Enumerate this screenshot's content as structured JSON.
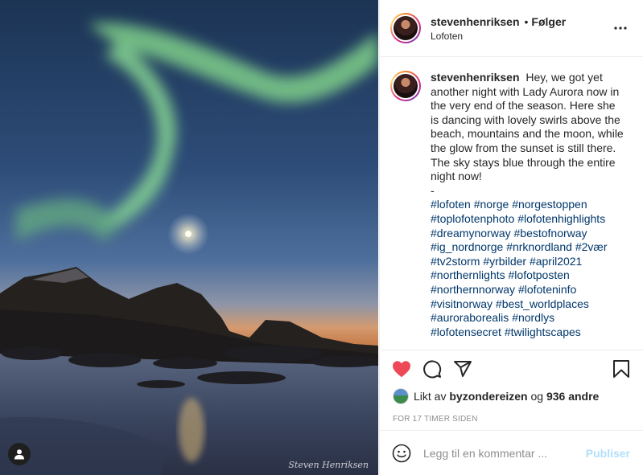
{
  "photo": {
    "user_tag_icon": "user-tag-icon",
    "watermark": "Steven Henriksen"
  },
  "header": {
    "username": "stevenhenriksen",
    "separator": "•",
    "follow_label": "Følger",
    "location": "Lofoten",
    "more_icon": "more-icon"
  },
  "caption": {
    "username": "stevenhenriksen",
    "text": "Hey, we got yet another night with Lady Aurora now in the very end of the season. Here she is dancing with lovely swirls above the beach, mountains and the moon, while the glow from the sunset is still there. The sky stays blue through the entire night now!",
    "dash": "-",
    "hashtags": [
      "#lofoten",
      "#norge",
      "#norgestoppen",
      "#toplofotenphoto",
      "#lofotenhighlights",
      "#dreamynorway",
      "#bestofnorway",
      "#ig_nordnorge",
      "#nrknordland",
      "#2vær",
      "#tv2storm",
      "#yrbilder",
      "#april2021",
      "#northernlights",
      "#lofotposten",
      "#northernnorway",
      "#lofoteninfo",
      "#visitnorway",
      "#best_worldplaces",
      "#auroraborealis",
      "#nordlys",
      "#lofotensecret",
      "#twilightscapes"
    ]
  },
  "actions": {
    "like_icon": "heart-icon",
    "comment_icon": "comment-icon",
    "share_icon": "share-icon",
    "save_icon": "bookmark-icon",
    "like_color": "#ed4956"
  },
  "likes": {
    "prefix": "Likt av",
    "user": "byzondereizen",
    "conjunction": "og",
    "others": "936 andre"
  },
  "timestamp": "FOR 17 TIMER SIDEN",
  "comment": {
    "emoji_icon": "emoji-icon",
    "placeholder": "Legg til en kommentar ...",
    "publish_label": "Publiser"
  }
}
